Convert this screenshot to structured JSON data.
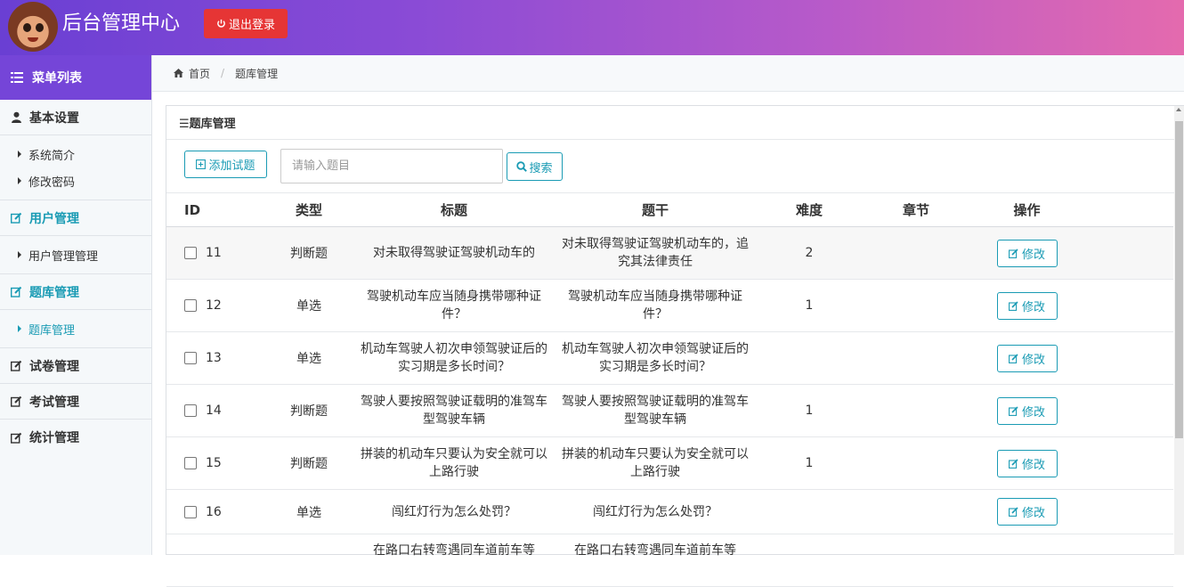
{
  "header": {
    "title": "后台管理中心",
    "logout_label": "退出登录"
  },
  "sidebar": {
    "menu_title": "菜单列表",
    "groups": [
      {
        "label": "基本设置",
        "icon": "user-icon",
        "subs": [
          "系统简介",
          "修改密码"
        ]
      },
      {
        "label": "用户管理",
        "icon": "edit-icon",
        "subs": [
          "用户管理管理"
        ]
      },
      {
        "label": "题库管理",
        "icon": "edit-icon",
        "subs": [
          "题库管理"
        ]
      },
      {
        "label": "试卷管理",
        "icon": "edit-icon",
        "subs": []
      },
      {
        "label": "考试管理",
        "icon": "edit-icon",
        "subs": []
      },
      {
        "label": "统计管理",
        "icon": "edit-icon",
        "subs": []
      }
    ]
  },
  "breadcrumb": {
    "home": "首页",
    "current": "题库管理"
  },
  "panel": {
    "title": "☰题库管理",
    "add_label": "添加试题",
    "search_placeholder": "请输入题目",
    "search_value": "",
    "search_label": "搜索"
  },
  "table": {
    "headers": {
      "id": "ID",
      "type": "类型",
      "title": "标题",
      "stem": "题干",
      "difficulty": "难度",
      "chapter": "章节",
      "action": "操作"
    },
    "edit_label": "修改",
    "rows": [
      {
        "id": "11",
        "type": "判断题",
        "title": "对未取得驾驶证驾驶机动车的",
        "stem": "对未取得驾驶证驾驶机动车的，追究其法律责任",
        "difficulty": "2",
        "chapter": ""
      },
      {
        "id": "12",
        "type": "单选",
        "title": "驾驶机动车应当随身携带哪种证件？",
        "stem": "驾驶机动车应当随身携带哪种证件？",
        "difficulty": "1",
        "chapter": ""
      },
      {
        "id": "13",
        "type": "单选",
        "title": "机动车驾驶人初次申领驾驶证后的实习期是多长时间？",
        "stem": "机动车驾驶人初次申领驾驶证后的实习期是多长时间？",
        "difficulty": "",
        "chapter": ""
      },
      {
        "id": "14",
        "type": "判断题",
        "title": "驾驶人要按照驾驶证载明的准驾车型驾驶车辆",
        "stem": "驾驶人要按照驾驶证载明的准驾车型驾驶车辆",
        "difficulty": "1",
        "chapter": ""
      },
      {
        "id": "15",
        "type": "判断题",
        "title": "拼装的机动车只要认为安全就可以上路行驶",
        "stem": "拼装的机动车只要认为安全就可以上路行驶",
        "difficulty": "1",
        "chapter": ""
      },
      {
        "id": "16",
        "type": "单选",
        "title": "闯红灯行为怎么处罚？",
        "stem": "闯红灯行为怎么处罚？",
        "difficulty": "",
        "chapter": ""
      },
      {
        "id": "",
        "type": "",
        "title": "在路口右转弯遇同车道前车等",
        "stem": "在路口右转弯遇同车道前车等",
        "difficulty": "",
        "chapter": ""
      }
    ]
  },
  "colors": {
    "header_gradient_start": "#6a3fd3",
    "header_gradient_end": "#e46aae",
    "logout": "#e63535",
    "accent": "#1a9bb4",
    "menu_head": "#7545d8"
  }
}
